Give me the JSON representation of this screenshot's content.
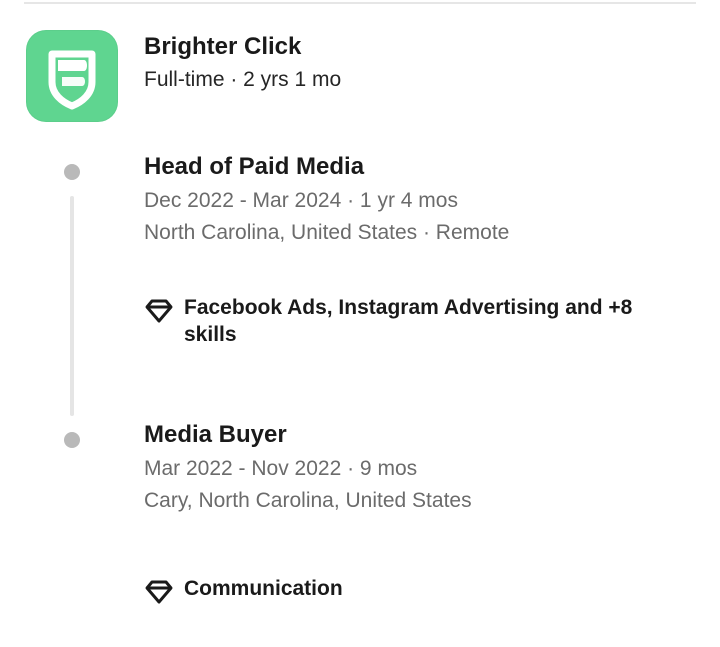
{
  "company": {
    "name": "Brighter Click",
    "meta": "Full-time · 2 yrs 1 mo",
    "logo_icon": "brighter-click-logo",
    "logo_color": "#5fd590"
  },
  "roles": [
    {
      "title": "Head of Paid Media",
      "dates": "Dec 2022 - Mar 2024 · 1 yr 4 mos",
      "location": "North Carolina, United States · Remote",
      "skills_icon": "diamond-icon",
      "skills": "Facebook Ads, Instagram Advertising and +8 skills"
    },
    {
      "title": "Media Buyer",
      "dates": "Mar 2022 - Nov 2022 · 9 mos",
      "location": "Cary, North Carolina, United States",
      "skills_icon": "diamond-icon",
      "skills": "Communication"
    }
  ]
}
